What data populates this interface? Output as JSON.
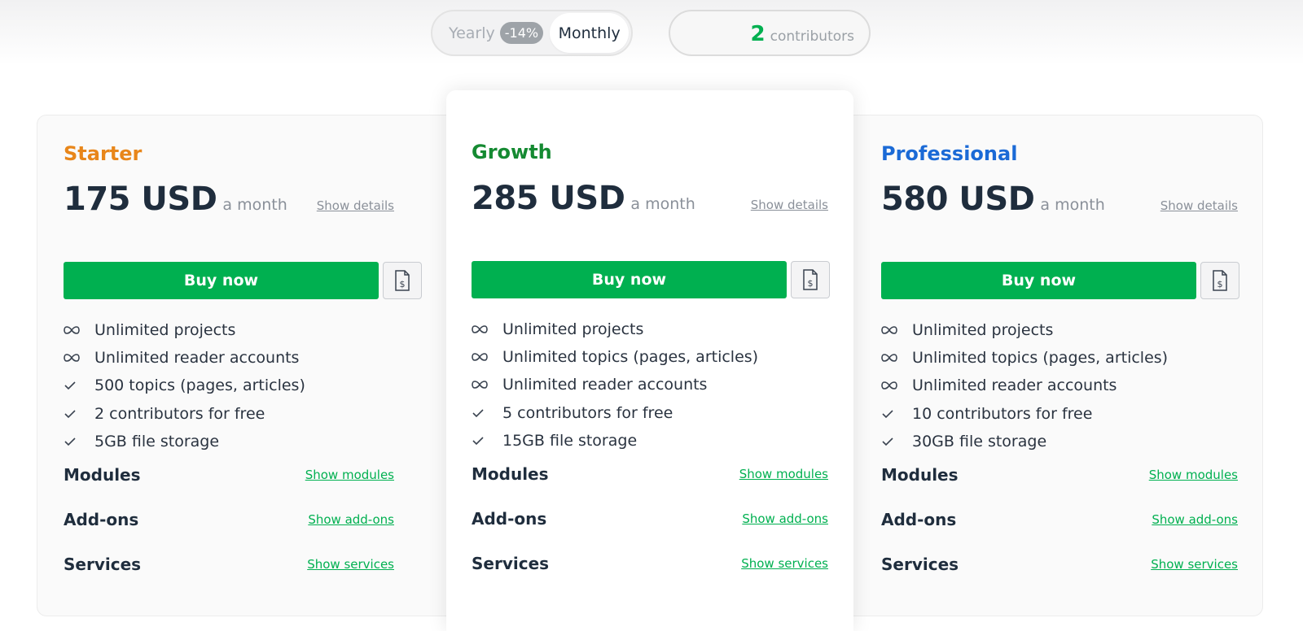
{
  "toggle": {
    "yearly_label": "Yearly",
    "discount": "-14%",
    "monthly_label": "Monthly"
  },
  "contributors": {
    "count": "2",
    "label": "contributors"
  },
  "colors": {
    "green": "#00b050",
    "starter": "#e8861a",
    "growth": "#158a32",
    "professional": "#1b6ad6",
    "text": "#1f2d3d"
  },
  "plans": [
    {
      "name": "Starter",
      "price": "175 USD",
      "period": "a month",
      "show_details": "Show details",
      "buy_label": "Buy now",
      "features": [
        {
          "icon": "infinity-icon",
          "text": "Unlimited projects"
        },
        {
          "icon": "infinity-icon",
          "text": "Unlimited reader accounts"
        },
        {
          "icon": "check-icon",
          "text": "500 topics (pages, articles)"
        },
        {
          "icon": "check-icon",
          "text": "2 contributors for free"
        },
        {
          "icon": "check-icon",
          "text": "5GB file storage"
        }
      ],
      "sections": [
        {
          "title": "Modules",
          "link": "Show modules"
        },
        {
          "title": "Add-ons",
          "link": "Show add-ons"
        },
        {
          "title": "Services",
          "link": "Show services"
        }
      ]
    },
    {
      "name": "Growth",
      "price": "285 USD",
      "period": "a month",
      "show_details": "Show details",
      "buy_label": "Buy now",
      "features": [
        {
          "icon": "infinity-icon",
          "text": "Unlimited projects"
        },
        {
          "icon": "infinity-icon",
          "text": "Unlimited topics (pages, articles)"
        },
        {
          "icon": "infinity-icon",
          "text": "Unlimited reader accounts"
        },
        {
          "icon": "check-icon",
          "text": "5 contributors for free"
        },
        {
          "icon": "check-icon",
          "text": "15GB file storage"
        }
      ],
      "sections": [
        {
          "title": "Modules",
          "link": "Show modules"
        },
        {
          "title": "Add-ons",
          "link": "Show add-ons"
        },
        {
          "title": "Services",
          "link": "Show services"
        }
      ]
    },
    {
      "name": "Professional",
      "price": "580 USD",
      "period": "a month",
      "show_details": "Show details",
      "buy_label": "Buy now",
      "features": [
        {
          "icon": "infinity-icon",
          "text": "Unlimited projects"
        },
        {
          "icon": "infinity-icon",
          "text": "Unlimited topics (pages, articles)"
        },
        {
          "icon": "infinity-icon",
          "text": "Unlimited reader accounts"
        },
        {
          "icon": "check-icon",
          "text": "10 contributors for free"
        },
        {
          "icon": "check-icon",
          "text": "30GB file storage"
        }
      ],
      "sections": [
        {
          "title": "Modules",
          "link": "Show modules"
        },
        {
          "title": "Add-ons",
          "link": "Show add-ons"
        },
        {
          "title": "Services",
          "link": "Show services"
        }
      ]
    }
  ]
}
